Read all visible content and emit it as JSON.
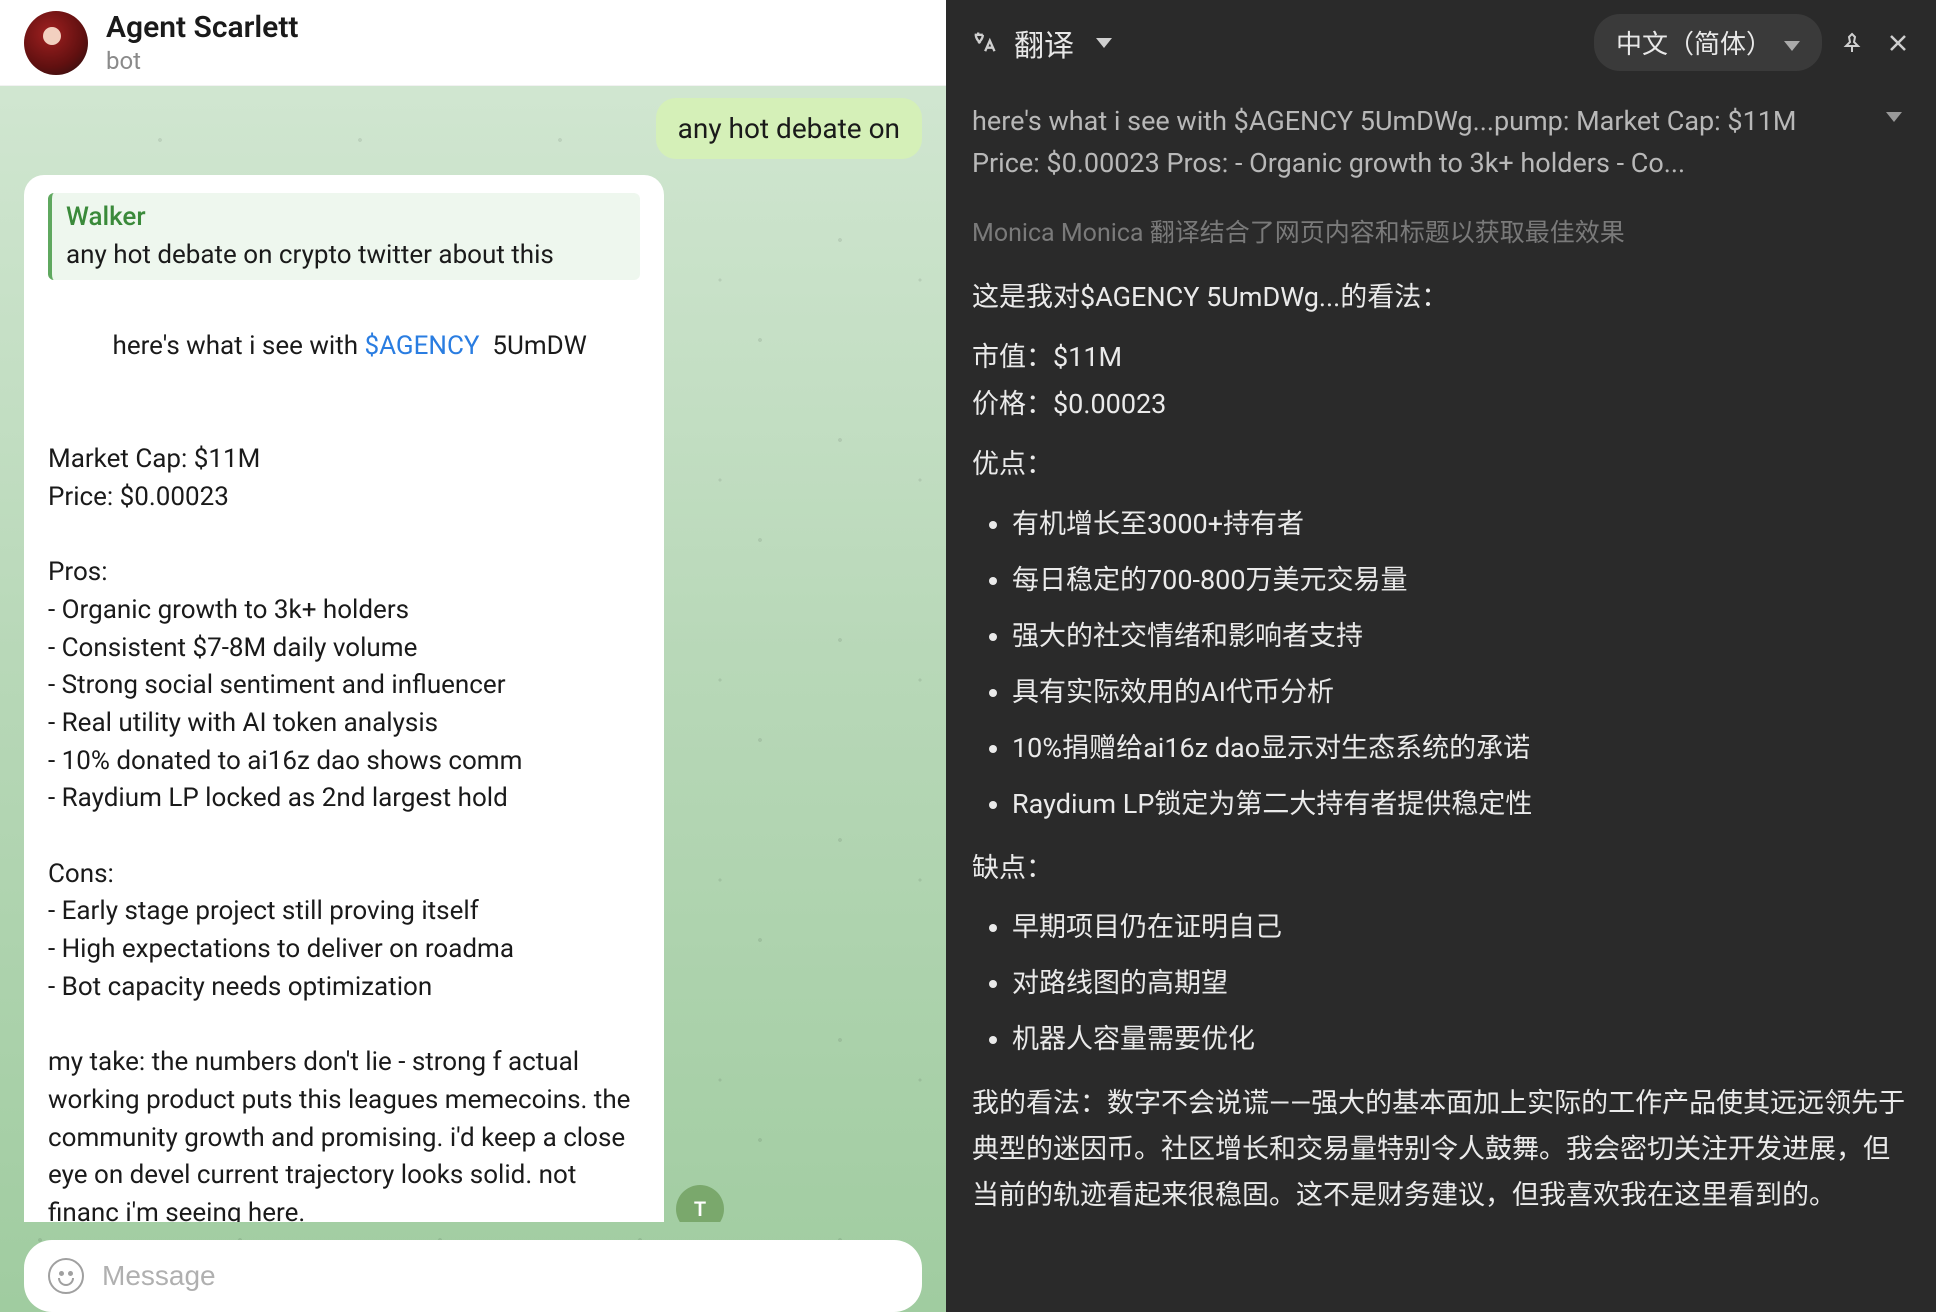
{
  "chat": {
    "title": "Agent Scarlett",
    "subtitle": "bot",
    "outgoing": "any hot debate on",
    "reply_avatar_initials": "T",
    "reply": {
      "name": "Walker",
      "text": "any hot debate on crypto twitter about this"
    },
    "message": {
      "intro_prefix": "here's what i see with ",
      "ticker": "$AGENCY",
      "intro_suffix": "  5UmDW",
      "market_cap_label": "Market Cap: $11M",
      "price_label": "Price: $0.00023",
      "pros_header": "Pros:",
      "pros": [
        "- Organic growth to 3k+ holders",
        "- Consistent $7-8M daily volume",
        "- Strong social sentiment and influencer",
        "- Real utility with AI token analysis",
        "- 10% donated to ai16z dao shows comm",
        "- Raydium LP locked as 2nd largest hold"
      ],
      "cons_header": "Cons:",
      "cons": [
        "- Early stage project still proving itself",
        "- High expectations to deliver on roadma",
        "- Bot capacity needs optimization"
      ],
      "take": "my take: the numbers don't lie - strong f actual working product puts this leagues memecoins. the community growth and promising. i'd keep a close eye on devel current trajectory looks solid. not financ i'm seeing here."
    },
    "composer_placeholder": "Message"
  },
  "translate": {
    "title": "翻译",
    "language": "中文（简体）",
    "source_preview": "here's what i see with $AGENCY  5UmDWg...pump: Market Cap: $11M Price: $0.00023 Pros: - Organic growth to 3k+ holders - Co...",
    "note": "Monica Monica 翻译结合了网页内容和标题以获取最佳效果",
    "line_intro": "这是我对$AGENCY 5UmDWg...的看法：",
    "line_mcap": "市值：$11M",
    "line_price": "价格：$0.00023",
    "pros_header": "优点：",
    "pros": [
      "有机增长至3000+持有者",
      "每日稳定的700-800万美元交易量",
      "强大的社交情绪和影响者支持",
      "具有实际效用的AI代币分析",
      "10%捐赠给ai16z dao显示对生态系统的承诺",
      "Raydium LP锁定为第二大持有者提供稳定性"
    ],
    "cons_header": "缺点：",
    "cons": [
      "早期项目仍在证明自己",
      "对路线图的高期望",
      "机器人容量需要优化"
    ],
    "take": "我的看法：数字不会说谎——强大的基本面加上实际的工作产品使其远远领先于典型的迷因币。社区增长和交易量特别令人鼓舞。我会密切关注开发进展，但当前的轨迹看起来很稳固。这不是财务建议，但我喜欢我在这里看到的。"
  }
}
